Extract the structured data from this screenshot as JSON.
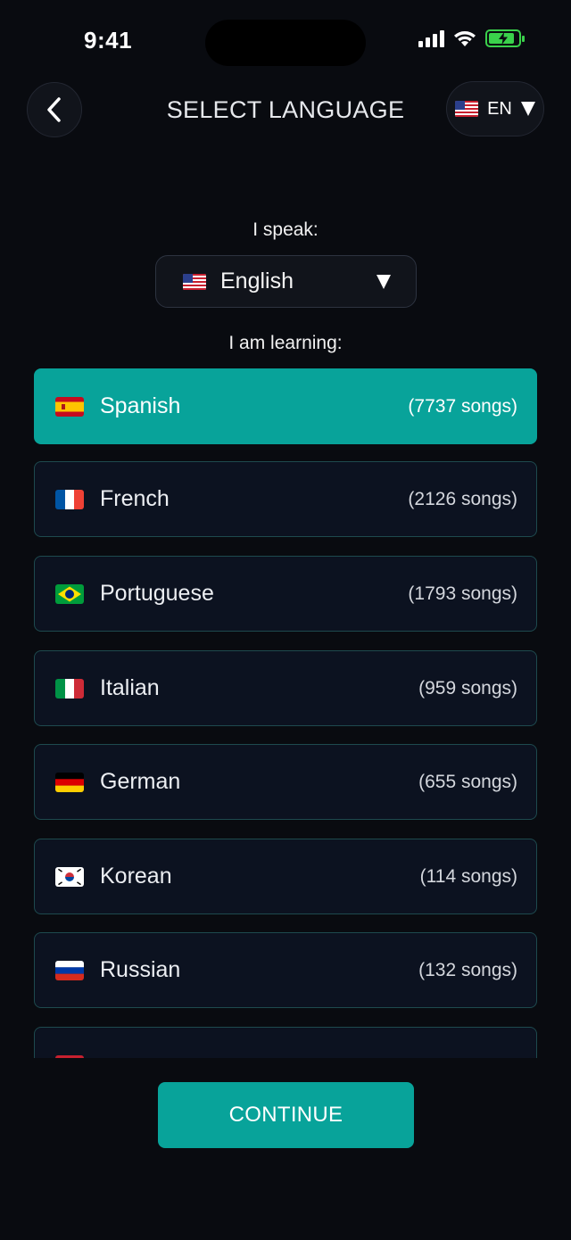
{
  "status_bar": {
    "time": "9:41"
  },
  "header": {
    "title": "SELECT LANGUAGE",
    "back_icon": "chevron-left-icon",
    "ui_language": {
      "code": "EN",
      "flag": "us-flag-icon"
    }
  },
  "speak": {
    "label": "I speak:",
    "selected": {
      "name": "English",
      "flag": "us-flag-icon"
    }
  },
  "learn": {
    "label": "I am learning:",
    "languages": [
      {
        "name": "Spanish",
        "count": "(7737 songs)",
        "flag": "es-flag-icon",
        "selected": true
      },
      {
        "name": "French",
        "count": "(2126 songs)",
        "flag": "fr-flag-icon",
        "selected": false
      },
      {
        "name": "Portuguese",
        "count": "(1793 songs)",
        "flag": "br-flag-icon",
        "selected": false
      },
      {
        "name": "Italian",
        "count": "(959 songs)",
        "flag": "it-flag-icon",
        "selected": false
      },
      {
        "name": "German",
        "count": "(655 songs)",
        "flag": "de-flag-icon",
        "selected": false
      },
      {
        "name": "Korean",
        "count": "(114 songs)",
        "flag": "kr-flag-icon",
        "selected": false
      },
      {
        "name": "Russian",
        "count": "(132 songs)",
        "flag": "ru-flag-icon",
        "selected": false
      }
    ]
  },
  "continue_label": "CONTINUE",
  "colors": {
    "background": "#090b10",
    "accent": "#08a39a",
    "card": "#0c1220",
    "card_border": "#1e4a4e"
  }
}
